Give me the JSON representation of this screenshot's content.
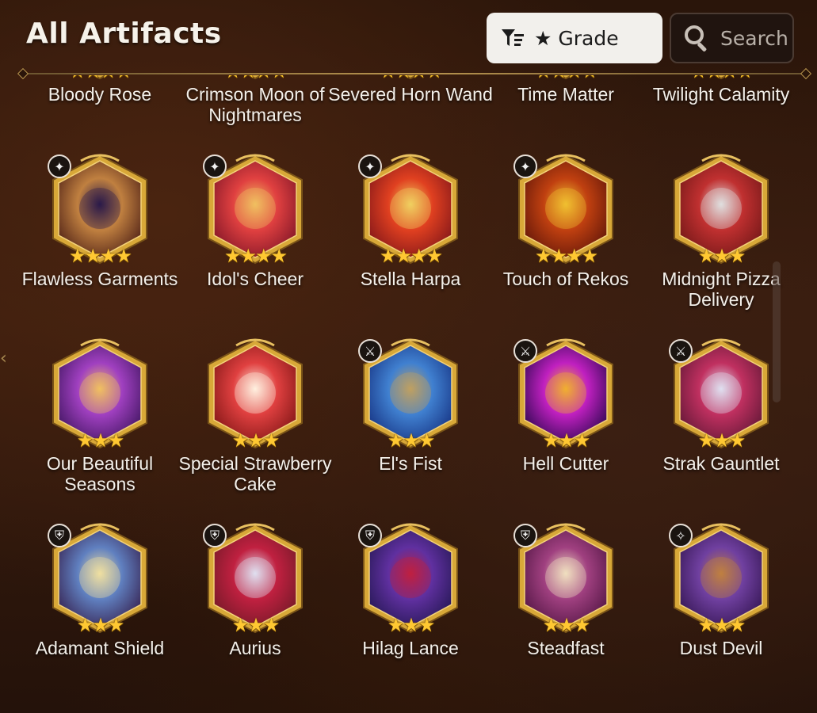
{
  "header": {
    "title": "All Artifacts",
    "sort_label": "★ Grade",
    "search_label": "Search"
  },
  "colors": {
    "star": "#ffc832",
    "frame_gold": "#d8a838",
    "title_text": "#f6f2ea"
  },
  "artifacts": [
    {
      "name": "Bloody Rose",
      "stars": 4,
      "role_icon": "",
      "art": [
        "#5a0d0d",
        "#c0302a",
        "#e8b040"
      ]
    },
    {
      "name": "Crimson Moon of Nightmares",
      "stars": 4,
      "role_icon": "",
      "art": [
        "#7a1a5a",
        "#ff40d0",
        "#ffd0f0"
      ]
    },
    {
      "name": "Severed Horn Wand",
      "stars": 4,
      "role_icon": "",
      "art": [
        "#1a4a2a",
        "#40c070",
        "#d0f0d0"
      ]
    },
    {
      "name": "Time Matter",
      "stars": 4,
      "role_icon": "",
      "art": [
        "#1a3a8a",
        "#40a0ff",
        "#c0e8ff"
      ]
    },
    {
      "name": "Twilight Calamity",
      "stars": 4,
      "role_icon": "",
      "art": [
        "#4a0a1a",
        "#c0203a",
        "#202040"
      ]
    },
    {
      "name": "Flawless Garments",
      "stars": 4,
      "role_icon": "mage-icon",
      "art": [
        "#5a2a1a",
        "#c08040",
        "#2a1a4a"
      ]
    },
    {
      "name": "Idol's Cheer",
      "stars": 4,
      "role_icon": "mage-icon",
      "art": [
        "#8a1a2a",
        "#e04040",
        "#f0c060"
      ]
    },
    {
      "name": "Stella Harpa",
      "stars": 4,
      "role_icon": "mage-icon",
      "art": [
        "#8a1a1a",
        "#e04020",
        "#f0d060"
      ]
    },
    {
      "name": "Touch of Rekos",
      "stars": 4,
      "role_icon": "mage-icon",
      "art": [
        "#6a1a0a",
        "#c04010",
        "#f0c030"
      ]
    },
    {
      "name": "Midnight Pizza Delivery",
      "stars": 3,
      "role_icon": "",
      "art": [
        "#7a1a1a",
        "#c03030",
        "#e0e0e0"
      ]
    },
    {
      "name": "Our Beautiful Seasons",
      "stars": 3,
      "role_icon": "",
      "art": [
        "#4a1a6a",
        "#a040c0",
        "#f0c060"
      ]
    },
    {
      "name": "Special Strawberry Cake",
      "stars": 3,
      "role_icon": "",
      "art": [
        "#8a1a1a",
        "#e04040",
        "#fff0e0"
      ]
    },
    {
      "name": "El's Fist",
      "stars": 3,
      "role_icon": "warrior-icon",
      "art": [
        "#1a3a8a",
        "#4080d0",
        "#c0a060"
      ]
    },
    {
      "name": "Hell Cutter",
      "stars": 3,
      "role_icon": "warrior-icon",
      "art": [
        "#3a0a5a",
        "#c020c0",
        "#f0b030"
      ]
    },
    {
      "name": "Strak Gauntlet",
      "stars": 3,
      "role_icon": "warrior-icon",
      "art": [
        "#6a1a3a",
        "#c03060",
        "#e0e0f0"
      ]
    },
    {
      "name": "Adamant Shield",
      "stars": 3,
      "role_icon": "knight-icon",
      "art": [
        "#3a2a5a",
        "#6080c0",
        "#f0e0a0"
      ]
    },
    {
      "name": "Aurius",
      "stars": 3,
      "role_icon": "knight-icon",
      "art": [
        "#7a1a2a",
        "#c02040",
        "#e0e0f0"
      ]
    },
    {
      "name": "Hilag Lance",
      "stars": 3,
      "role_icon": "knight-icon",
      "art": [
        "#2a1a5a",
        "#6030a0",
        "#c02040"
      ]
    },
    {
      "name": "Steadfast",
      "stars": 3,
      "role_icon": "knight-icon",
      "art": [
        "#5a1a4a",
        "#a04080",
        "#f0e0c0"
      ]
    },
    {
      "name": "Dust Devil",
      "stars": 3,
      "role_icon": "soul-weaver-icon",
      "art": [
        "#3a1a5a",
        "#7040a0",
        "#c08040"
      ]
    }
  ]
}
